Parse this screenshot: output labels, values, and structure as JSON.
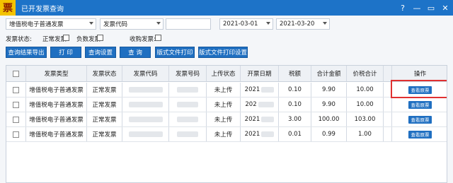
{
  "titlebar": {
    "logo": "票",
    "title": "已开发票查询"
  },
  "window_controls": {
    "icons": [
      "help-icon",
      "minimize-icon",
      "maximize-icon",
      "close-icon"
    ],
    "glyphs": [
      "?",
      "—",
      "▭",
      "✕"
    ]
  },
  "filters": {
    "invoice_kind": "增值税电子普通发票",
    "search_field": "发票代码",
    "search_value": "",
    "date_from": "2021-03-01",
    "date_to": "2021-03-20"
  },
  "status_filters": {
    "label": "发票状态:",
    "normal": "正常发票",
    "negative": "负数发票",
    "purchase": "收购发票:"
  },
  "toolbar": {
    "export": "查询结果导出",
    "print": "打 印",
    "settings": "查询设置",
    "query": "查 询",
    "layout_print": "版式文件打印",
    "layout_print_settings": "版式文件打印设置"
  },
  "table": {
    "headers": [
      "",
      "发票类型",
      "发票状态",
      "发票代码",
      "发票号码",
      "上传状态",
      "开票日期",
      "税额",
      "合计金额",
      "价税合计",
      "",
      "操作"
    ],
    "rows": [
      {
        "type": "增值税电子普通发票",
        "status": "正常发票",
        "upload": "未上传",
        "date": "2021",
        "tax": "0.10",
        "total": "9.90",
        "sum": "10.00",
        "action": "查看原票"
      },
      {
        "type": "增值税电子普通发票",
        "status": "正常发票",
        "upload": "未上传",
        "date": "202",
        "tax": "0.10",
        "total": "9.90",
        "sum": "10.00",
        "action": "查看原票"
      },
      {
        "type": "增值税电子普通发票",
        "status": "正常发票",
        "upload": "未上传",
        "date": "2021",
        "tax": "3.00",
        "total": "100.00",
        "sum": "103.00",
        "action": "查看原票"
      },
      {
        "type": "增值税电子普通发票",
        "status": "正常发票",
        "upload": "未上传",
        "date": "2021",
        "tax": "0.01",
        "total": "0.99",
        "sum": "1.00",
        "action": "查看原票"
      }
    ]
  },
  "colors": {
    "titlebar": "#1d73c8",
    "button": "#1f6fc1",
    "highlight": "#e03131"
  }
}
